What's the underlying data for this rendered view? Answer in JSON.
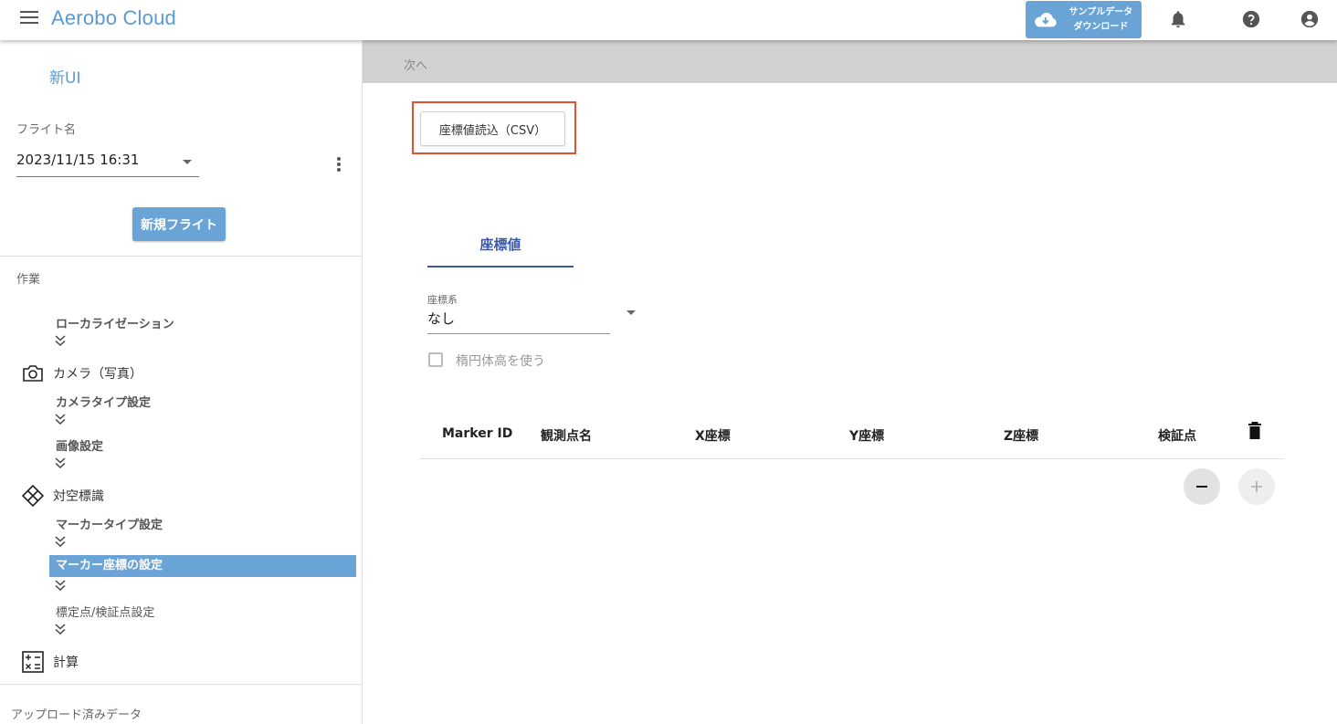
{
  "header": {
    "title": "Aerobo Cloud",
    "sample_download_line1": "サンプルデータ",
    "sample_download_line2": "ダウンロード"
  },
  "sidebar": {
    "new_ui": "新UI",
    "flight_label": "フライト名",
    "flight_value": "2023/11/15 16:31",
    "new_flight_button": "新規フライト",
    "work_label": "作業",
    "steps": {
      "localization": "ローカライゼーション",
      "camera_group": "カメラ（写真）",
      "camera_type": "カメラタイプ設定",
      "image_settings": "画像設定",
      "gcp_group": "対空標識",
      "marker_type": "マーカータイプ設定",
      "marker_coords": "マーカー座標の設定",
      "calib_points": "標定点/検証点設定",
      "calc_group": "計算"
    },
    "uploaded_label": "アップロード済みデータ"
  },
  "main": {
    "next_label": "次へ",
    "csv_button": "座標値読込（CSV）",
    "tab_label": "座標値",
    "coord_system_label": "座標系",
    "coord_system_value": "なし",
    "ellipsoid_checkbox_label": "楕円体高を使う",
    "table_headers": [
      "Marker ID",
      "観測点名",
      "X座標",
      "Y座標",
      "Z座標",
      "検証点"
    ]
  },
  "colors": {
    "brand": "#5b9ad3",
    "accent": "#6aa3d6",
    "tab_active": "#3b57a8",
    "highlight": "#e0502e"
  }
}
